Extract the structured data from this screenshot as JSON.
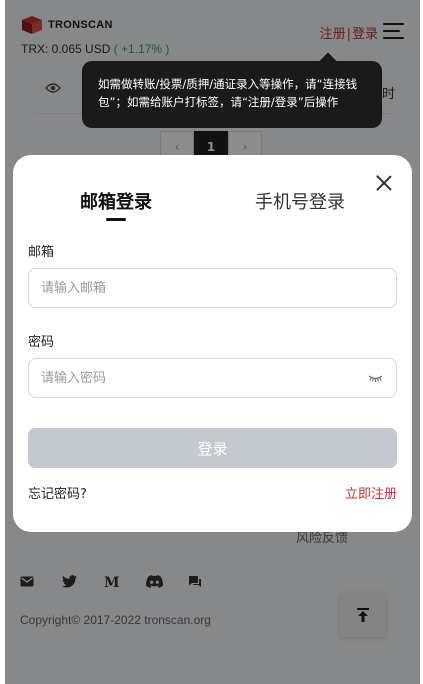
{
  "header": {
    "logo_text": "TRONSCAN",
    "price_label": "TRX: 0.065 USD",
    "price_change": "( +1.17% )",
    "register": "注册",
    "separator": "|",
    "login": "登录"
  },
  "background": {
    "row_time": "21 小时",
    "pager_prev": "‹",
    "pager_current": "1",
    "pager_next": "›",
    "risk_feedback": "风险反馈",
    "copyright": "Copyright© 2017-2022 tronscan.org",
    "social_icons": [
      "mail-icon",
      "twitter-icon",
      "medium-icon",
      "discord-icon",
      "chat-icon"
    ]
  },
  "tooltip": {
    "text": "如需做转账/投票/质押/通证录入等操作，请“连接钱包”；如需给账户打标签，请“注册/登录”后操作"
  },
  "modal": {
    "tab_email": "邮箱登录",
    "tab_phone": "手机号登录",
    "email_label": "邮箱",
    "email_placeholder": "请输入邮箱",
    "password_label": "密码",
    "password_placeholder": "请输入密码",
    "login_button": "登录",
    "forgot_password": "忘记密码?",
    "register_now": "立即注册"
  },
  "colors": {
    "accent_red": "#c23631",
    "positive_green": "#2da86d",
    "disabled_button": "#c4c9d0"
  }
}
